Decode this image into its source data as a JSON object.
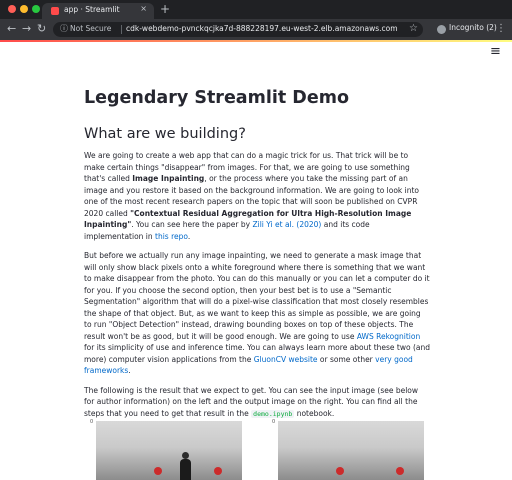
{
  "browser": {
    "tab_title": "app · Streamlit",
    "tab_close": "×",
    "new_tab": "+",
    "nav": {
      "back": "←",
      "forward": "→",
      "reload": "↻"
    },
    "security_label": "Not Secure",
    "url": "cdk-webdemo-pvnckqcjka7d-888228197.eu-west-2.elb.amazonaws.com",
    "incognito_label": "Incognito (2)",
    "menu": "⋮",
    "star": "☆",
    "info": "ⓘ",
    "accent_color": "#ff4b4b"
  },
  "page": {
    "menu_icon": "≡",
    "title": "Legendary Streamlit Demo",
    "section_heading": "What are we building?",
    "p1": {
      "t1": "We are going to create a web app that can do a magic trick for us. That trick will be to make certain things \"disappear\" from images. For that, we are going to use something that's called ",
      "b1": "Image Inpainting",
      "t2": ", or the process where you take the missing part of an image and you restore it based on the background information. We are going to look into one of the most recent research papers on the topic that will soon be published on CVPR 2020 called ",
      "b2": "\"Contextual Residual Aggregation for Ultra High-Resolution Image Inpainting\"",
      "t3": ". You can see here the paper by ",
      "link1": "Zili Yi et al. (2020)",
      "t4": " and its code implementation in ",
      "link2": "this repo",
      "t5": "."
    },
    "p2": {
      "t1": "But before we actually run any image inpainting, we need to generate a mask image that will only show black pixels onto a white foreground where there is something that we want to make disappear from the photo. You can do this manually or you can let a computer do it for you. If you choose the second option, then your best bet is to use a \"Semantic Segmentation\" algorithm that will do a pixel-wise classification that most closely resembles the shape of that object. But, as we want to keep this as simple as possible, we are going to run \"Object Detection\" instead, drawing bounding boxes on top of these objects. The result won't be as good, but it will be good enough. We are going to use ",
      "link1": "AWS Rekognition",
      "t2": " for its simplicity of use and inference time. You can always learn more about these two (and more) computer vision applications from the ",
      "link2": "GluonCV website",
      "t3": " or some other ",
      "link3": "very good frameworks",
      "t4": "."
    },
    "p3": {
      "t1": "The following is the result that we expect to get. You can see the input image (see below for author information) on the left and the output image on the right. You can find all the steps that you need to get that result in the ",
      "code": "demo.ipynb",
      "t2": " notebook."
    },
    "figures": {
      "left_tick": "0",
      "right_tick": "0"
    }
  }
}
